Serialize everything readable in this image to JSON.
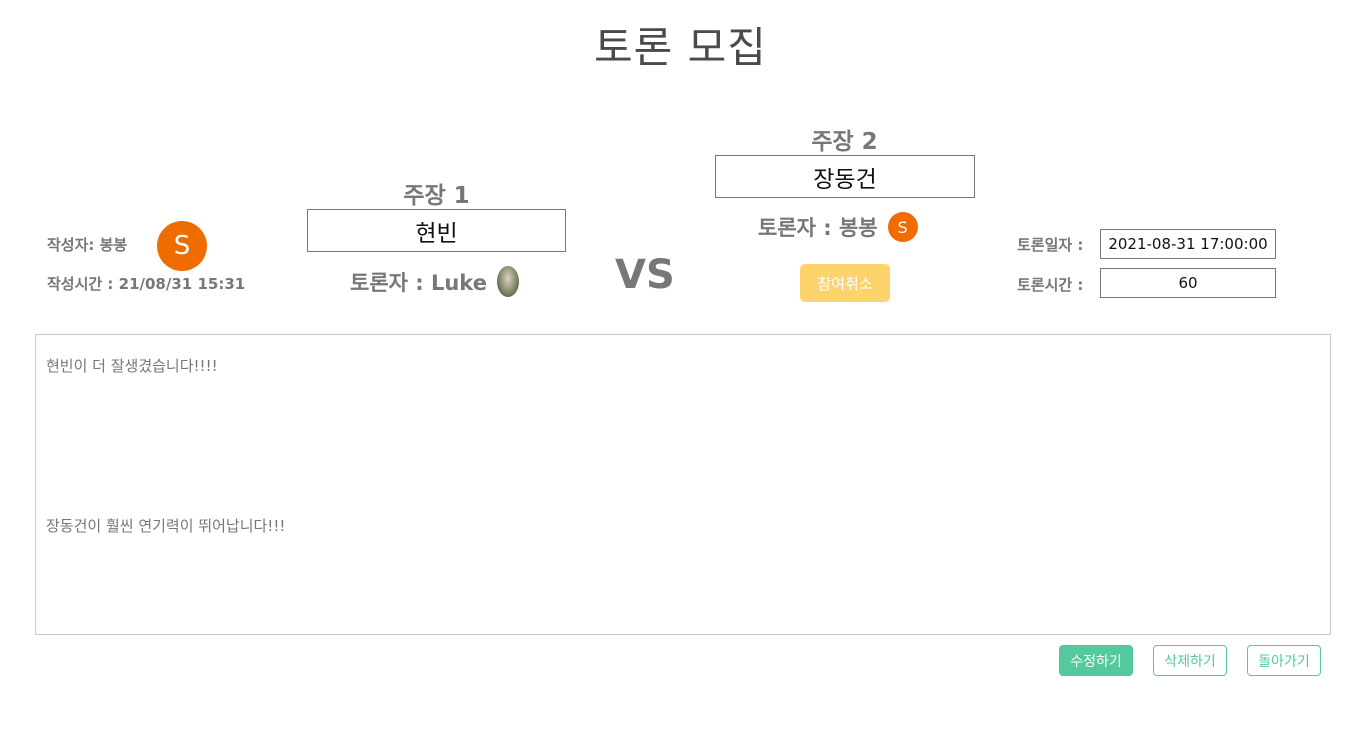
{
  "page": {
    "title": "토론 모집"
  },
  "author": {
    "label": "작성자: 봉봉",
    "avatar_letter": "S",
    "time": "작성시간 : 21/08/31 15:31"
  },
  "claim1": {
    "title": "주장 1",
    "value": "현빈",
    "debater": "토론자 : Luke"
  },
  "claim2": {
    "title": "주장 2",
    "value": "장동건",
    "debater": "토론자 : 봉봉",
    "avatar_letter": "S",
    "join_cancel_label": "참여취소"
  },
  "vs_label": "VS",
  "info": {
    "date_label": "토론일자 :",
    "date_value": "2021-08-31 17:00:00",
    "duration_label": "토론시간 :",
    "duration_value": "60"
  },
  "content": {
    "line1": "현빈이 더 잘생겼습니다!!!!",
    "line2": "장동건이 훨씬 연기력이 뛰어납니다!!!"
  },
  "buttons": {
    "edit": "수정하기",
    "delete": "삭제하기",
    "back": "돌아가기"
  },
  "colors": {
    "accent_green": "#55c99e",
    "avatar_orange": "#ef6c00",
    "join_cancel_yellow": "#ffd36b"
  }
}
